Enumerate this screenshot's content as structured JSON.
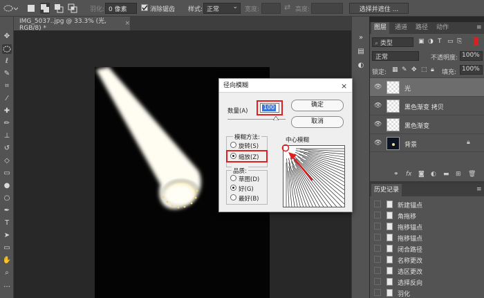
{
  "options_bar": {
    "feather_label": "羽化:",
    "feather_value": "0 像素",
    "antialias_label": "消除锯齿",
    "style_label": "样式:",
    "style_value": "正常",
    "width_label": "宽度:",
    "height_label": "高度:",
    "select_mask_label": "选择并遮住 ..."
  },
  "document_tab": {
    "title": "IMG_5037..jpg @ 33.3% (光, RGB/8) *",
    "close": "×"
  },
  "dialog": {
    "title": "径向模糊",
    "close": "×",
    "amount_label": "数量(A)",
    "amount_value": "100",
    "ok_label": "确定",
    "cancel_label": "取消",
    "blur_method_label": "模糊方法:",
    "method_spin": "旋转(S)",
    "method_zoom": "缩放(Z)",
    "quality_label": "品质:",
    "quality_draft": "草图(D)",
    "quality_good": "好(G)",
    "quality_best": "最好(B)",
    "center_label": "中心模糊"
  },
  "layers_panel": {
    "tabs": [
      "图层",
      "通道",
      "路径",
      "动作"
    ],
    "kind_label": "类型",
    "blend_mode": "正常",
    "opacity_label": "不透明度:",
    "opacity_value": "100%",
    "lock_label": "锁定:",
    "fill_label": "填充:",
    "fill_value": "100%",
    "layers": [
      {
        "name": "光",
        "selected": true
      },
      {
        "name": "黑色渐变 拷贝",
        "selected": false
      },
      {
        "name": "黑色渐变",
        "selected": false
      },
      {
        "name": "背景",
        "selected": false
      }
    ]
  },
  "history_panel": {
    "title": "历史记录",
    "items": [
      "新建锚点",
      "角拖移",
      "拖移锚点",
      "拖移锚点",
      "闭合路径",
      "名称更改",
      "选区更改",
      "选择反向",
      "羽化"
    ]
  },
  "colors": {
    "ui_dark": "#535353",
    "highlight_red": "#e02020",
    "amount_field": "#3a74d8"
  }
}
